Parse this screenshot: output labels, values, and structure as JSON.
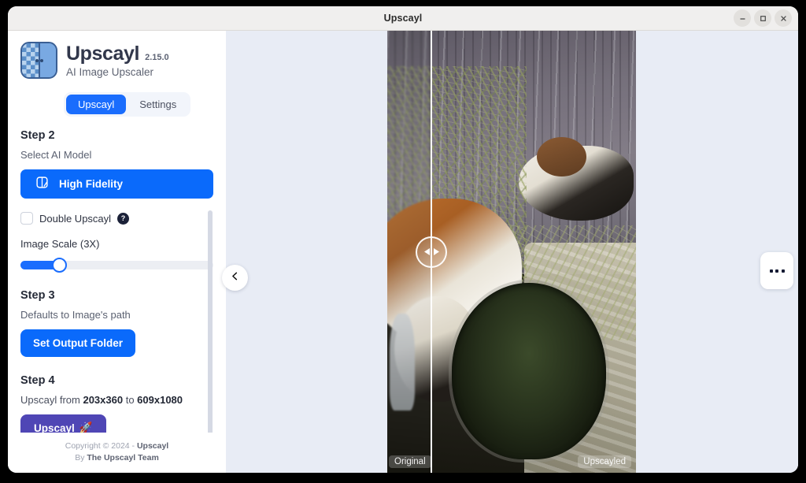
{
  "window": {
    "title": "Upscayl",
    "controls": {
      "minimize": "minimize-icon",
      "maximize": "maximize-icon",
      "close": "close-icon"
    }
  },
  "sidebar": {
    "brand": {
      "name": "Upscayl",
      "version": "2.15.0",
      "tagline": "AI Image Upscaler",
      "logo": "upscayl-logo-icon"
    },
    "tabs": [
      {
        "label": "Upscayl",
        "active": true
      },
      {
        "label": "Settings",
        "active": false
      }
    ],
    "step2": {
      "heading": "Step 2",
      "subtitle": "Select AI Model",
      "model_button": {
        "label": "High Fidelity",
        "icon": "image-model-icon"
      },
      "double_upscayl": {
        "label": "Double Upscayl",
        "checked": false,
        "help_badge": "?"
      },
      "image_scale": {
        "label": "Image Scale (3X)",
        "value": "3X",
        "percent": 20
      }
    },
    "step3": {
      "heading": "Step 3",
      "subtitle": "Defaults to Image's path",
      "button_label": "Set Output Folder"
    },
    "step4": {
      "heading": "Step 4",
      "description_prefix": "Upscayl from ",
      "source_resolution": "203x360",
      "description_middle": " to ",
      "target_resolution": "609x1080",
      "button_label": "Upscayl",
      "button_emoji": "🚀"
    },
    "footer": {
      "line1_prefix": "Copyright © 2024 - ",
      "line1_strong": "Upscayl",
      "line2_prefix": "By ",
      "line2_strong": "The Upscayl Team"
    },
    "collapse_button": "chevron-left-icon",
    "scrollbar": "sidebar-scrollbar"
  },
  "viewer": {
    "compare_handle": "compare-slider-handle",
    "labels": {
      "original": "Original",
      "upscayled": "Upscayled"
    },
    "overflow_menu": "more-options-icon"
  },
  "colors": {
    "accent_blue": "#0a6afb",
    "accent_purple": "#4f46b5",
    "viewer_bg": "#e8ecf5",
    "titlebar_bg": "#f0efee",
    "badge_dark": "#1b2138"
  }
}
